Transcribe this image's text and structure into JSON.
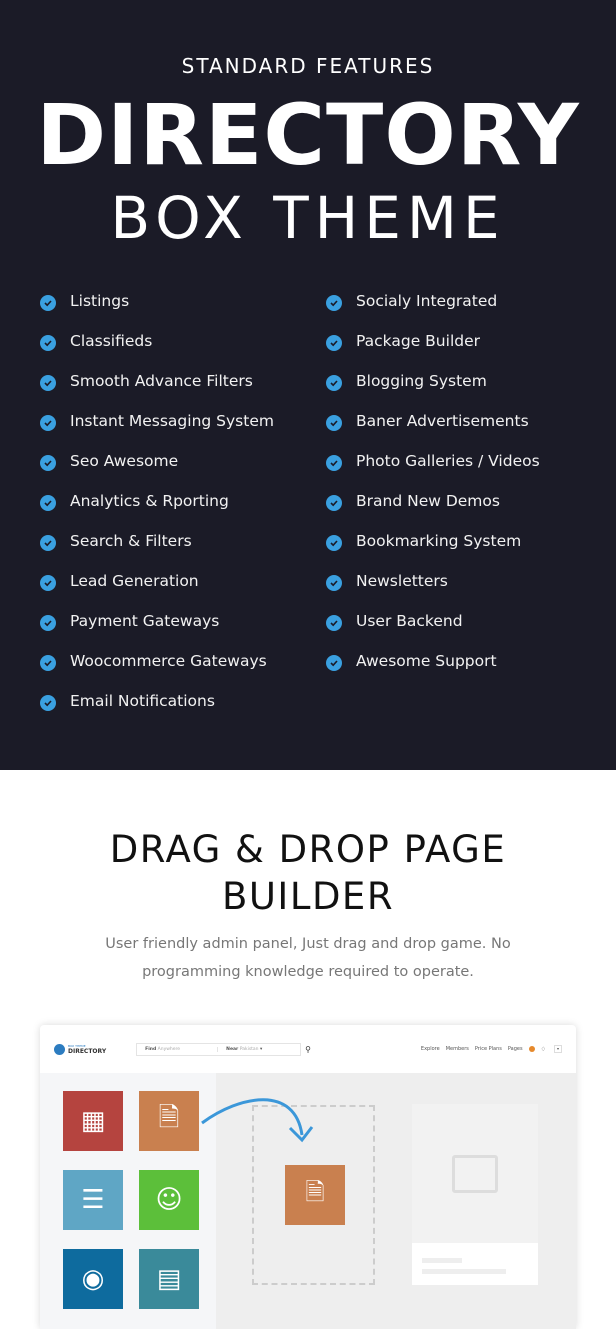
{
  "hero": {
    "subtitle": "STANDARD FEATURES",
    "title": "DIRECTORY",
    "title2": "BOX THEME"
  },
  "features_left": [
    "Listings",
    "Classifieds",
    "Smooth Advance Filters",
    "Instant Messaging System",
    "Seo Awesome",
    "Analytics & Rporting",
    "Search & Filters",
    "Lead Generation",
    "Payment Gateways",
    "Woocommerce Gateways",
    "Email Notifications"
  ],
  "features_right": [
    "Socialy Integrated",
    "Package Builder",
    "Blogging System",
    "Baner Advertisements",
    "Photo Galleries / Videos",
    "Brand New Demos",
    "Bookmarking System",
    "Newsletters",
    "User Backend",
    "Awesome Support"
  ],
  "builder": {
    "title_line1": "DRAG & DROP PAGE",
    "title_line2": "BUILDER",
    "desc_line1": "User friendly admin panel, Just drag and drop game. No",
    "desc_line2": "programming knowledge required to operate."
  },
  "mockup": {
    "logo_small": "BOX THEME",
    "logo": "DIRECTORY",
    "find_label": "Find",
    "find_placeholder": "Anywhere",
    "near_label": "Near",
    "near_placeholder": "Pakistan",
    "nav": [
      "Explore",
      "Members",
      "Price Plans",
      "Pages"
    ]
  },
  "colors": {
    "background": "#1b1b27",
    "check": "#3aa0e0",
    "tiles": [
      "#b5443f",
      "#c9804f",
      "#5fa6c5",
      "#5cbf3a",
      "#0e6b9e",
      "#3a8a9a"
    ]
  }
}
